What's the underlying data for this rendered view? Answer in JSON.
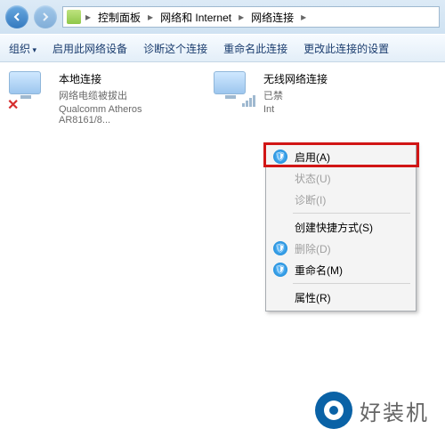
{
  "breadcrumb": {
    "items": [
      "控制面板",
      "网络和 Internet",
      "网络连接"
    ]
  },
  "toolbar": {
    "organize": "组织",
    "enable_device": "启用此网络设备",
    "diagnose": "诊断这个连接",
    "rename": "重命名此连接",
    "change_settings": "更改此连接的设置"
  },
  "connections": [
    {
      "title": "本地连接",
      "status": "网络电缆被拔出",
      "adapter": "Qualcomm Atheros AR8161/8..."
    },
    {
      "title": "无线网络连接",
      "status": "已禁",
      "adapter": "Int"
    }
  ],
  "context_menu": {
    "enable": "启用(A)",
    "status": "状态(U)",
    "diagnose": "诊断(I)",
    "shortcut": "创建快捷方式(S)",
    "delete": "删除(D)",
    "rename": "重命名(M)",
    "properties": "属性(R)"
  },
  "watermark": "好装机"
}
